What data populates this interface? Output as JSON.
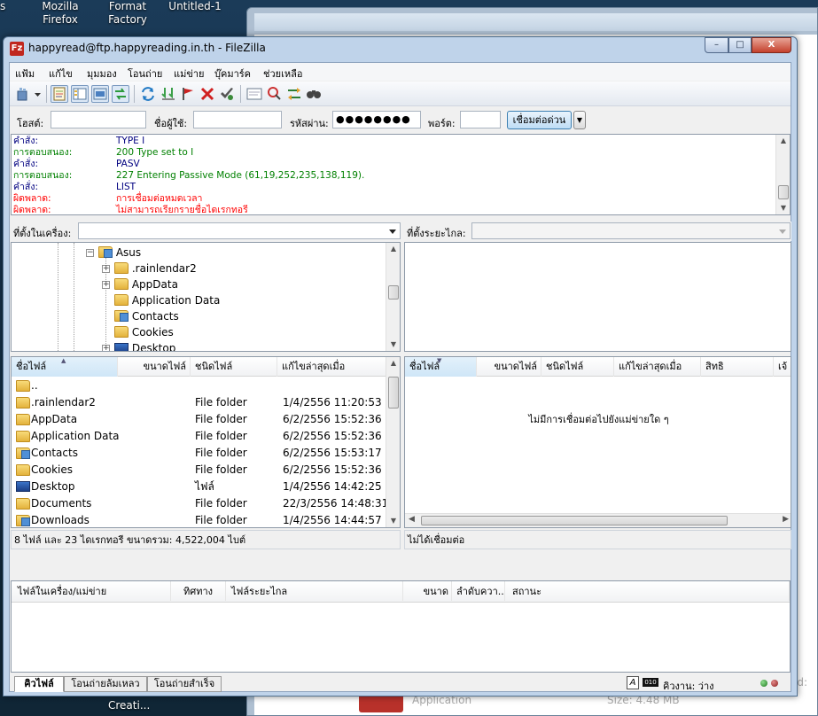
{
  "desktop": {
    "icons": [
      {
        "line1": "Mozilla",
        "line2": "Firefox"
      },
      {
        "line1": "Format",
        "line2": "Factory"
      },
      {
        "line1": "Untitled-1",
        "line2": ""
      }
    ],
    "bottom_label": "Creati...",
    "s_label": "s",
    "bg_labels": {
      "application": "Application",
      "size": "Size: 4.48 MB",
      "ed": "ed:"
    }
  },
  "window": {
    "title": "happyread@ftp.happyreading.in.th - FileZilla",
    "buttons": {
      "minimize": "–",
      "maximize": "□",
      "close": "X"
    }
  },
  "menu": [
    "แฟ้ม",
    "แก้ไข",
    "มุมมอง",
    "โอนถ่าย",
    "แม่ข่าย",
    "บุ๊คมาร์ค",
    "ช่วยเหลือ"
  ],
  "toolbar_icons": [
    "site-manager-icon",
    "dropdown-arrow-icon",
    "log-toggle-icon",
    "tree-toggle-icon",
    "remote-tree-icon",
    "queue-toggle-icon",
    "refresh-icon",
    "process-queue-icon",
    "stop-icon",
    "disconnect-icon",
    "reconnect-icon",
    "filter-icon",
    "compare-icon",
    "sync-browse-icon",
    "search-icon"
  ],
  "quickconnect": {
    "host_label": "โฮสต์:",
    "host_value": "",
    "user_label": "ชื่อผู้ใช้:",
    "user_value": "",
    "pass_label": "รหัสผ่าน:",
    "pass_value": "●●●●●●●●",
    "port_label": "พอร์ต:",
    "port_value": "",
    "connect_label": "เชื่อมต่อด่วน",
    "dropdown": "▼"
  },
  "log": [
    {
      "key": "คำสั่ง:",
      "value": "TYPE I",
      "kind": "command"
    },
    {
      "key": "การตอบสนอง:",
      "value": "200 Type set to I",
      "kind": "response"
    },
    {
      "key": "คำสั่ง:",
      "value": "PASV",
      "kind": "command"
    },
    {
      "key": "การตอบสนอง:",
      "value": "227 Entering Passive Mode (61,19,252,235,138,119).",
      "kind": "response"
    },
    {
      "key": "คำสั่ง:",
      "value": "LIST",
      "kind": "command"
    },
    {
      "key": "ผิดพลาด:",
      "value": "การเชื่อมต่อหมดเวลา",
      "kind": "error"
    },
    {
      "key": "ผิดพลาด:",
      "value": "ไม่สามารถเรียกรายชื่อไดเรกทอรี",
      "kind": "error"
    }
  ],
  "colors": {
    "command": "#000080",
    "response": "#008000",
    "error": "#ff0000"
  },
  "local": {
    "path_label": "ที่ตั้งในเครื่อง:",
    "tree": [
      {
        "label": "Asus",
        "icon": "user-folder",
        "expander": "−",
        "indent": 0
      },
      {
        "label": ".rainlendar2",
        "icon": "folder",
        "expander": "+",
        "indent": 1
      },
      {
        "label": "AppData",
        "icon": "folder",
        "expander": "+",
        "indent": 1
      },
      {
        "label": "Application Data",
        "icon": "folder",
        "expander": "",
        "indent": 1
      },
      {
        "label": "Contacts",
        "icon": "special-folder",
        "expander": "",
        "indent": 1
      },
      {
        "label": "Cookies",
        "icon": "folder",
        "expander": "",
        "indent": 1
      },
      {
        "label": "Desktop",
        "icon": "desktop",
        "expander": "+",
        "indent": 1
      }
    ],
    "columns": [
      "ชื่อไฟล์",
      "ขนาดไฟล์",
      "ชนิดไฟล์",
      "แก้ไขล่าสุดเมื่อ"
    ],
    "files": [
      {
        "name": "..",
        "size": "",
        "type": "",
        "modified": "",
        "icon": "folder"
      },
      {
        "name": ".rainlendar2",
        "size": "",
        "type": "File folder",
        "modified": "1/4/2556 11:20:53",
        "icon": "folder"
      },
      {
        "name": "AppData",
        "size": "",
        "type": "File folder",
        "modified": "6/2/2556 15:52:36",
        "icon": "folder"
      },
      {
        "name": "Application Data",
        "size": "",
        "type": "File folder",
        "modified": "6/2/2556 15:52:36",
        "icon": "folder"
      },
      {
        "name": "Contacts",
        "size": "",
        "type": "File folder",
        "modified": "6/2/2556 15:53:17",
        "icon": "special-folder"
      },
      {
        "name": "Cookies",
        "size": "",
        "type": "File folder",
        "modified": "6/2/2556 15:52:36",
        "icon": "folder"
      },
      {
        "name": "Desktop",
        "size": "",
        "type": "ไฟล์",
        "modified": "1/4/2556 14:42:25",
        "icon": "desktop"
      },
      {
        "name": "Documents",
        "size": "",
        "type": "File folder",
        "modified": "22/3/2556 14:48:31",
        "icon": "folder"
      },
      {
        "name": "Downloads",
        "size": "",
        "type": "File folder",
        "modified": "1/4/2556 14:44:57",
        "icon": "special-folder"
      }
    ],
    "status": "8 ไฟล์ และ 23 ไดเรกทอรี ขนาดรวม: 4,522,004 ไบต์"
  },
  "remote": {
    "path_label": "ที่ตั้งระยะไกล:",
    "columns": [
      "ชื่อไฟล์",
      "ขนาดไฟล์",
      "ชนิดไฟล์",
      "แก้ไขล่าสุดเมื่อ",
      "สิทธิ",
      "เจ้"
    ],
    "empty_message": "ไม่มีการเชื่อมต่อไปยังแม่ข่ายใด ๆ",
    "status": "ไม่ได้เชื่อมต่อ"
  },
  "queue": {
    "columns": [
      "ไฟล์ในเครื่อง/แม่ข่าย",
      "ทิศทาง",
      "ไฟล์ระยะไกล",
      "ขนาด",
      "ลำดับควา...",
      "สถานะ"
    ],
    "tabs": [
      "คิวไฟล์",
      "โอนถ่ายล้มเหลว",
      "โอนถ่ายสำเร็จ"
    ]
  },
  "statusbar": {
    "queue_label": "คิวงาน: ว่าง",
    "filter_icon_text": "A",
    "binary_icon_text": "010"
  }
}
